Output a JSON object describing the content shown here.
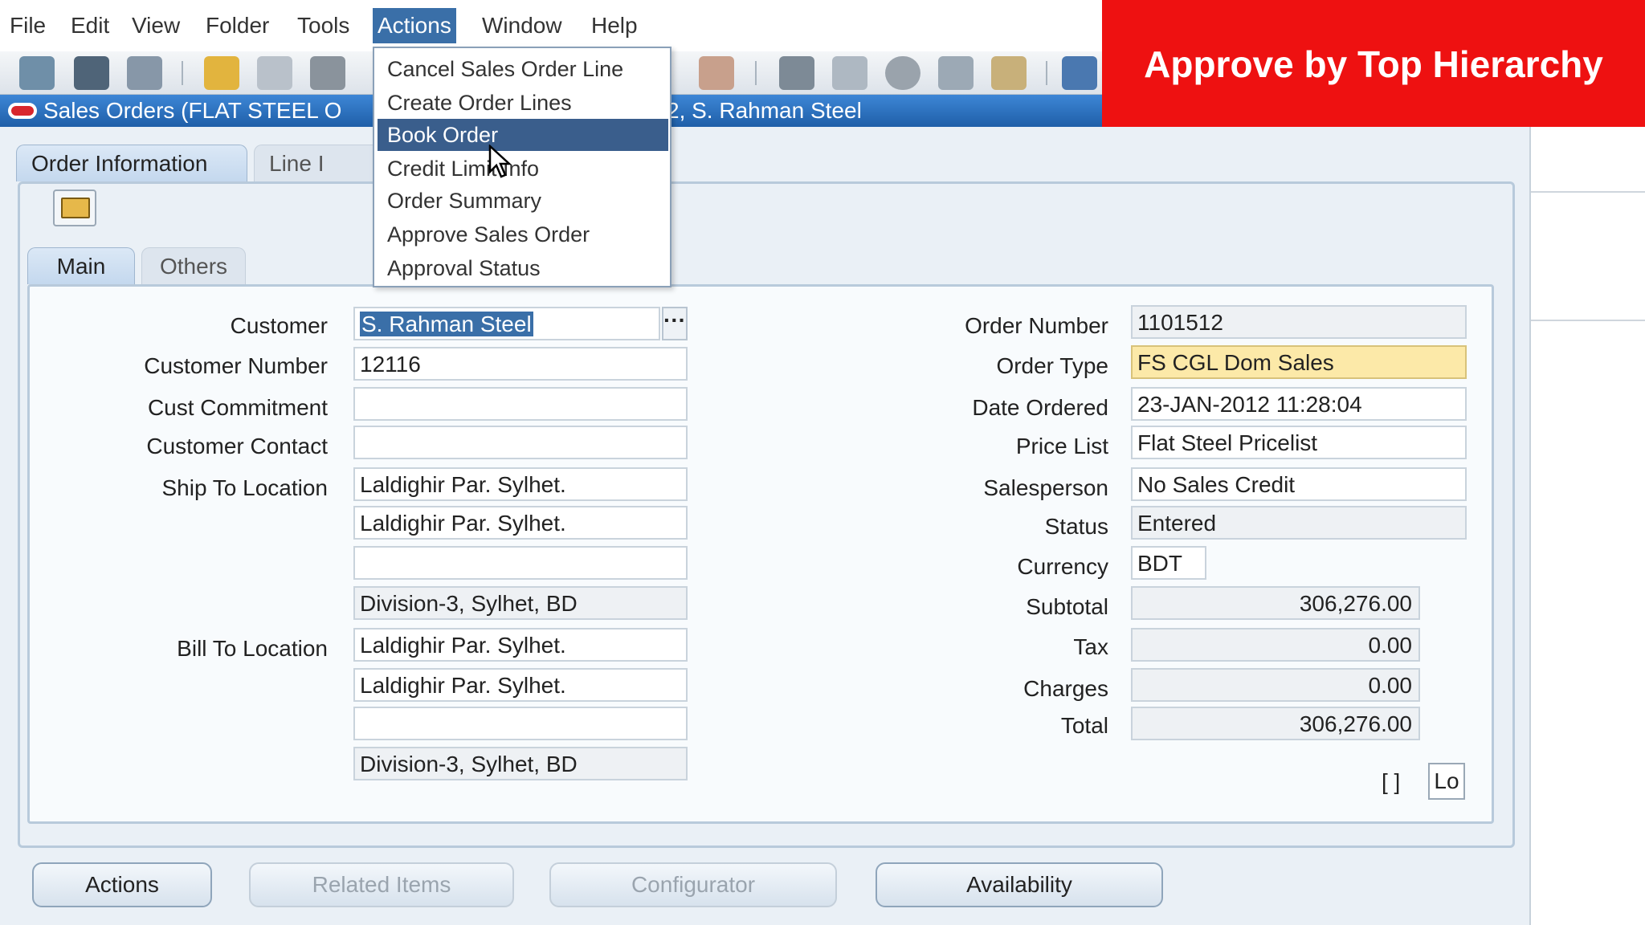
{
  "menubar": {
    "items": [
      "File",
      "Edit",
      "View",
      "Folder",
      "Tools",
      "Actions",
      "Window",
      "Help"
    ],
    "active": "Actions"
  },
  "banner": {
    "text": "Approve by Top Hierarchy"
  },
  "window": {
    "title_left": "Sales Orders (FLAT STEEL O",
    "title_right": "2, S. Rahman Steel"
  },
  "tabs": {
    "top": [
      "Order Information",
      "Line I"
    ],
    "sub": [
      "Main",
      "Others"
    ]
  },
  "dropdown": {
    "items": [
      "Cancel Sales Order Line",
      "Create Order Lines",
      "Book Order",
      "Credit Limit Info",
      "Order Summary",
      "Approve Sales Order",
      "Approval Status"
    ],
    "highlighted": "Book Order"
  },
  "form_left": {
    "customer_label": "Customer",
    "customer_value": "S. Rahman Steel",
    "customer_number_label": "Customer Number",
    "customer_number_value": "12116",
    "cust_commitment_label": "Cust Commitment",
    "cust_commitment_value": "",
    "customer_contact_label": "Customer Contact",
    "customer_contact_value": "",
    "ship_to_label": "Ship To Location",
    "ship_to_lines": [
      "Laldighir Par. Sylhet.",
      "Laldighir Par. Sylhet.",
      "",
      "Division-3, Sylhet, BD"
    ],
    "bill_to_label": "Bill To Location",
    "bill_to_lines": [
      "Laldighir Par. Sylhet.",
      "Laldighir Par. Sylhet.",
      "",
      "Division-3, Sylhet, BD"
    ],
    "lov_glyph": "···"
  },
  "form_right": {
    "order_number_label": "Order Number",
    "order_number_value": "1101512",
    "order_type_label": "Order Type",
    "order_type_value": "FS CGL Dom Sales",
    "date_ordered_label": "Date Ordered",
    "date_ordered_value": "23-JAN-2012 11:28:04",
    "price_list_label": "Price List",
    "price_list_value": "Flat Steel Pricelist",
    "salesperson_label": "Salesperson",
    "salesperson_value": "No Sales Credit",
    "status_label": "Status",
    "status_value": "Entered",
    "currency_label": "Currency",
    "currency_value": "BDT",
    "subtotal_label": "Subtotal",
    "subtotal_value": "306,276.00",
    "tax_label": "Tax",
    "tax_value": "0.00",
    "charges_label": "Charges",
    "charges_value": "0.00",
    "total_label": "Total",
    "total_value": "306,276.00",
    "brackets": "[ ]",
    "small_box": "Lo"
  },
  "buttons": {
    "actions": "Actions",
    "related_items": "Related Items",
    "configurator": "Configurator",
    "availability": "Availability"
  },
  "colors": {
    "banner": "#ee1111",
    "titlebar": "#1f5fa8",
    "menu_active": "#3a6fa8",
    "highlight_field": "#fce9a8"
  }
}
